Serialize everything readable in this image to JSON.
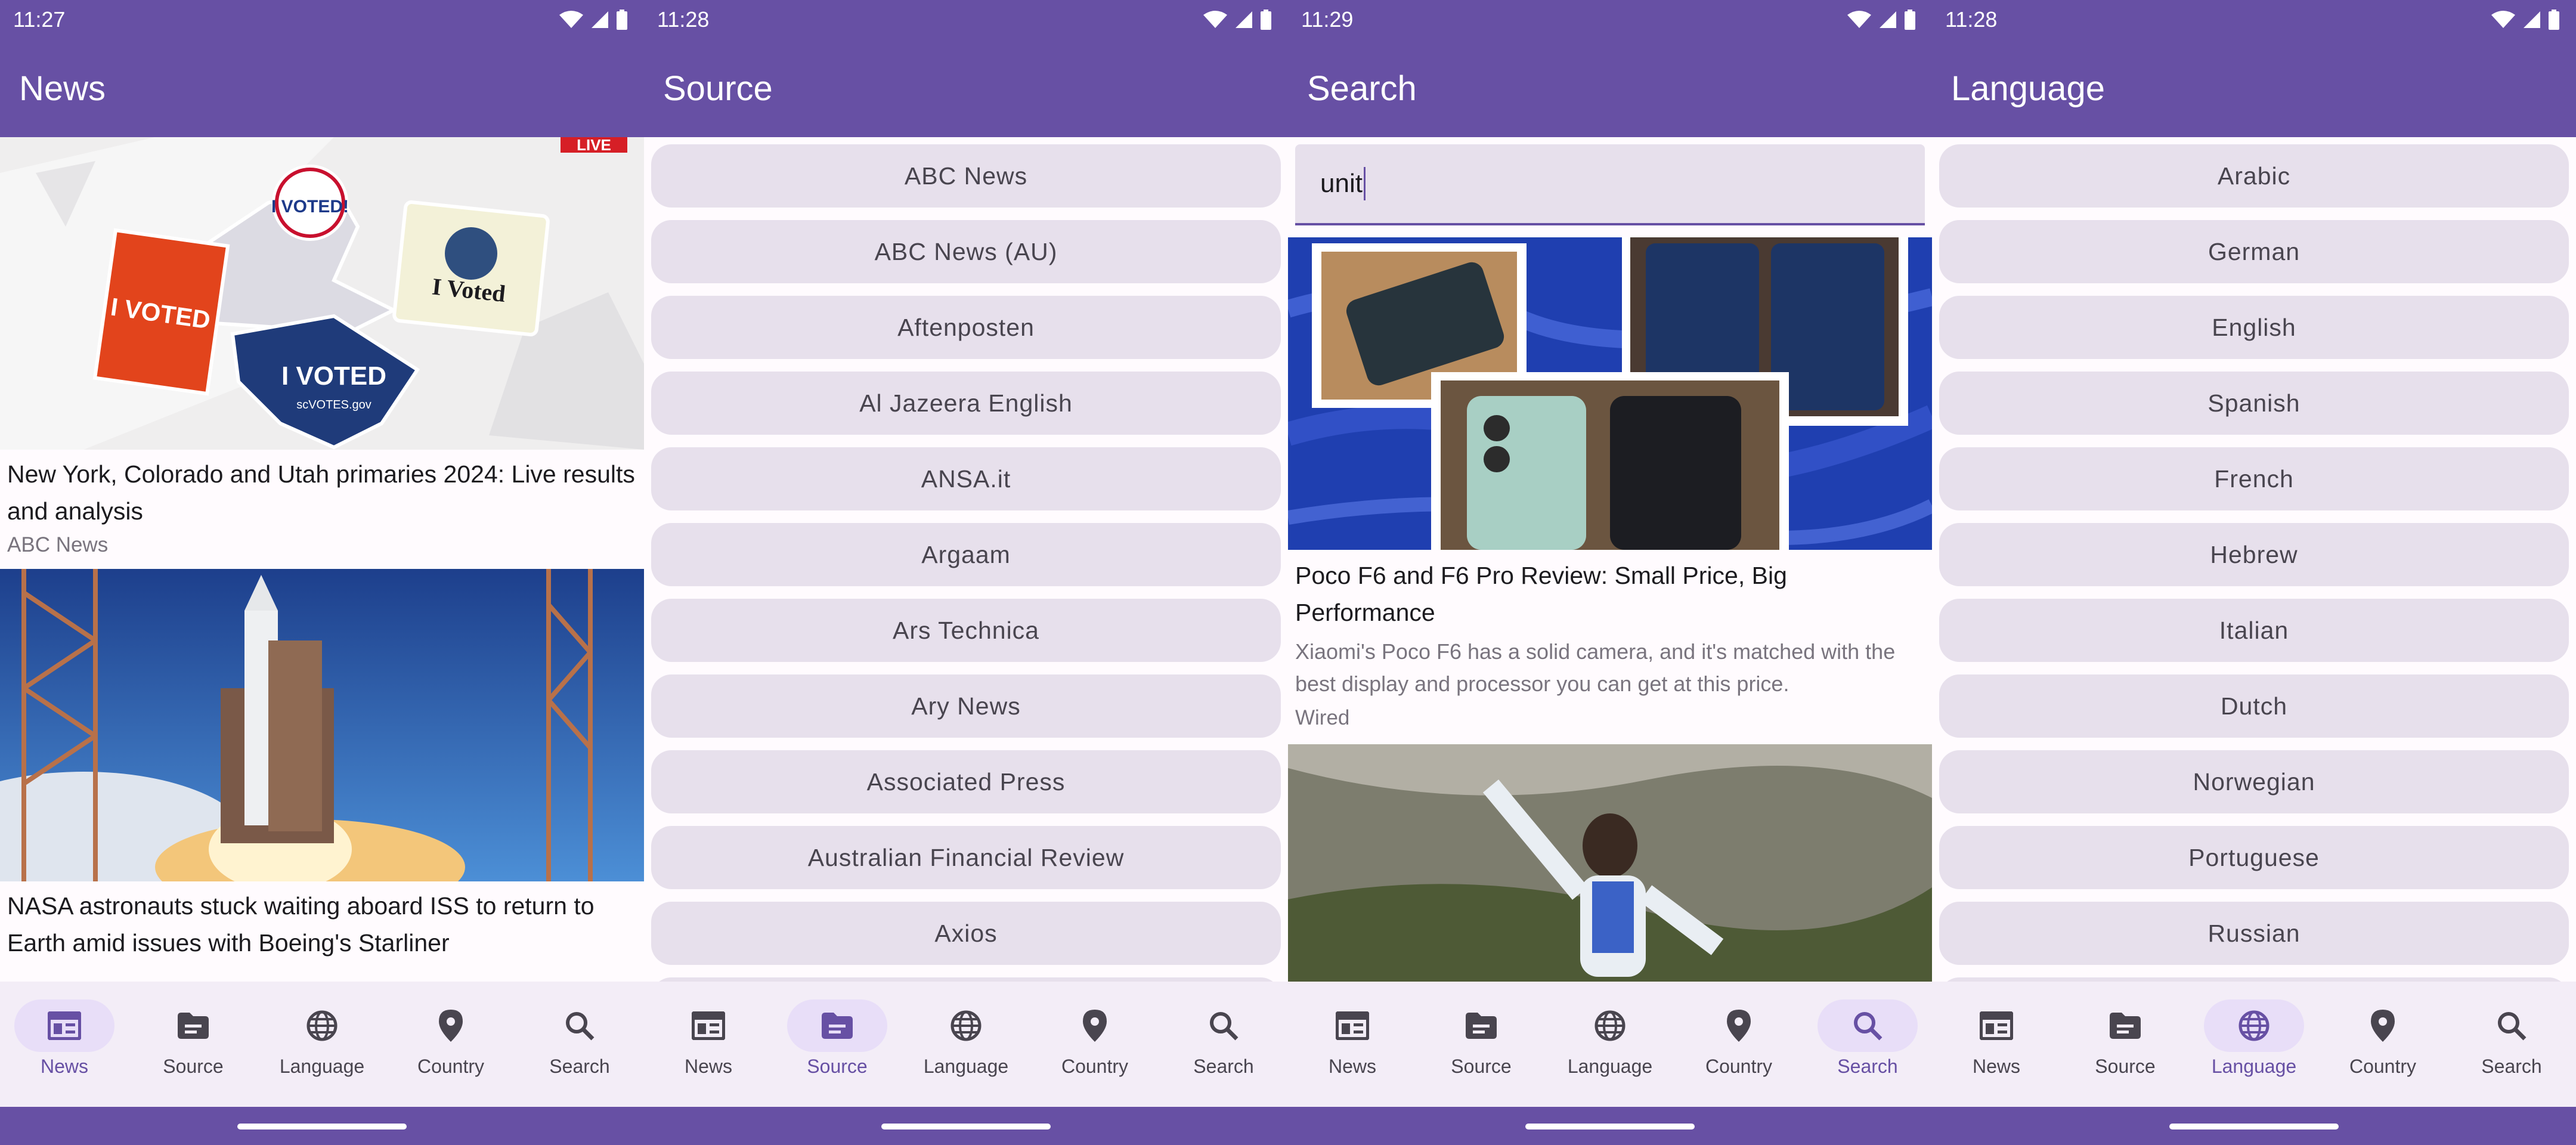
{
  "colors": {
    "primary": "#6750a4",
    "surface": "#fffbfe",
    "nav_bg": "#f3edf7",
    "pill_bg": "#e7e0ec",
    "active_pill": "#e8def8"
  },
  "nav_items": [
    "News",
    "Source",
    "Language",
    "Country",
    "Search"
  ],
  "screens": {
    "news": {
      "time": "11:27",
      "title": "News",
      "live_badge": "LIVE",
      "articles": [
        {
          "title": "New York, Colorado and Utah primaries 2024: Live results and analysis",
          "source": "ABC News",
          "sticker_texts": [
            "I VOTED!",
            "I VOTED",
            "I VOTED",
            "I Voted",
            "scVOTES.gov"
          ]
        },
        {
          "title": "NASA astronauts stuck waiting aboard ISS to return to Earth amid issues with Boeing's Starliner"
        }
      ],
      "active_tab": "News"
    },
    "source": {
      "time": "11:28",
      "title": "Source",
      "items": [
        "ABC News",
        "ABC News (AU)",
        "Aftenposten",
        "Al Jazeera English",
        "ANSA.it",
        "Argaam",
        "Ars Technica",
        "Ary News",
        "Associated Press",
        "Australian Financial Review",
        "Axios"
      ],
      "active_tab": "Source"
    },
    "search": {
      "time": "11:29",
      "title": "Search",
      "query": "unit",
      "articles": [
        {
          "title": "Poco F6 and F6 Pro Review: Small Price, Big Performance",
          "description": "Xiaomi's Poco F6 has a solid camera, and it's matched with the best display and processor you can get at this price.",
          "source": "Wired"
        }
      ],
      "active_tab": "Search"
    },
    "language": {
      "time": "11:28",
      "title": "Language",
      "items": [
        "Arabic",
        "German",
        "English",
        "Spanish",
        "French",
        "Hebrew",
        "Italian",
        "Dutch",
        "Norwegian",
        "Portuguese",
        "Russian"
      ],
      "active_tab": "Language"
    }
  }
}
